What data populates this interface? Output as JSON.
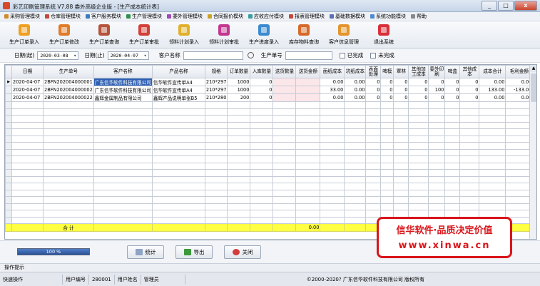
{
  "window": {
    "title": "彩艺印刷管理系统   V7.88   委外高级企业版 - [生产成本统计表]",
    "min": "_",
    "max": "□",
    "close": "x"
  },
  "menu": [
    {
      "label": "采购管理模块",
      "color": "#d08a2a"
    },
    {
      "label": "仓库管理模块",
      "color": "#c24a3b"
    },
    {
      "label": "客户服务模块",
      "color": "#3b7bc2"
    },
    {
      "label": "生产管理模块",
      "color": "#2f8f4b"
    },
    {
      "label": "委外管理模块",
      "color": "#a04ab5"
    },
    {
      "label": "合同报价模块",
      "color": "#c9a227"
    },
    {
      "label": "应收应付模块",
      "color": "#3a9ea0"
    },
    {
      "label": "报表管理模块",
      "color": "#c24a3b"
    },
    {
      "label": "基础数据模块",
      "color": "#5b6fb5"
    },
    {
      "label": "系统功能模块",
      "color": "#4d8ad0"
    },
    {
      "label": "帮助",
      "color": "#888888"
    }
  ],
  "toolbar": [
    {
      "label": "生产订单录入",
      "color": "#f0a020",
      "icon": "order-entry-icon"
    },
    {
      "label": "生产订单修改",
      "color": "#e07b2a",
      "icon": "order-edit-icon"
    },
    {
      "label": "生产订单查询",
      "color": "#b5533c",
      "icon": "order-query-icon"
    },
    {
      "label": "生产订单审批",
      "color": "#d2403a",
      "icon": "order-approve-icon"
    },
    {
      "label": "领料计划录入",
      "color": "#e1b12d",
      "icon": "material-plan-icon"
    },
    {
      "label": "领料计划审批",
      "color": "#c2378f",
      "icon": "material-approve-icon"
    },
    {
      "label": "生产进度录入",
      "color": "#3b8bd0",
      "icon": "progress-entry-icon"
    },
    {
      "label": "库存物料查询",
      "color": "#d66a2c",
      "icon": "inventory-query-icon"
    },
    {
      "label": "客户信息管理",
      "color": "#e3952b",
      "icon": "customer-info-icon"
    },
    {
      "label": "退出系统",
      "color": "#d8303a",
      "icon": "exit-icon"
    }
  ],
  "filter": {
    "date_from_label": "日期(起)",
    "date_from": "2020-03-08",
    "date_to_label": "日期(止)",
    "date_to": "2020-04-07",
    "customer_label": "客户名称",
    "customer": "",
    "order_label": "生产单号",
    "order": "",
    "done_label": "已完成",
    "undone_label": "未完成"
  },
  "table": {
    "columns": [
      "日期",
      "生产单号",
      "客户名称",
      "产品名称",
      "规格",
      "订单数量",
      "入库数量",
      "送货数量",
      "送货金额",
      "面纸成本",
      "坑纸成本",
      "表面处理",
      "啤模",
      "覃林",
      "其他加工成本",
      "委外印刷",
      "啤盒",
      "其他成本",
      "成本合计",
      "毛利金额"
    ],
    "rows": [
      [
        "2020-04-07",
        "2BFN202004000001",
        "广东信华软件科技有限公司",
        "信华软件宣传单A4",
        "210*297",
        "1000",
        "0",
        "",
        "",
        "0.00",
        "0.00",
        "0",
        "0",
        "0",
        "0",
        "0",
        "0",
        "0",
        "0.00",
        "0.00"
      ],
      [
        "2020-04-07",
        "2BFN202004000002",
        "广东信华软件科技有限公司",
        "信华软件宣传单A4",
        "210*297",
        "1000",
        "0",
        "",
        "",
        "33.00",
        "0.00",
        "0",
        "0",
        "0",
        "0",
        "100",
        "0",
        "0",
        "133.00",
        "-133.00"
      ],
      [
        "2020-04-07",
        "2BFN202004000022",
        "鑫辉金属制品有限公司",
        "鑫辉产品说明单张B5",
        "210*280",
        "200",
        "0",
        "",
        "",
        "0.00",
        "0.00",
        "0",
        "0",
        "0",
        "0",
        "0",
        "0",
        "0",
        "0.00",
        "0.00"
      ]
    ],
    "total_label": "合  计",
    "total_delivery_amount": "0.00"
  },
  "bottom": {
    "progress_text": "100 %",
    "progress": 1.0,
    "stats_label": "统计",
    "export_label": "导出",
    "close_label": "关闭"
  },
  "brand": {
    "slogan": "信华软件·品质决定价值",
    "site": "www.xinwa.cn"
  },
  "hint": "操作提示",
  "status": {
    "quick_ops": "快速操作",
    "user_id_label": "用户编号",
    "user_id": "280001",
    "user_name_label": "用户姓名",
    "user_name": "管理员",
    "copyright": "©2000-2020?   广东信华软件科技有限公司   版权所有"
  }
}
